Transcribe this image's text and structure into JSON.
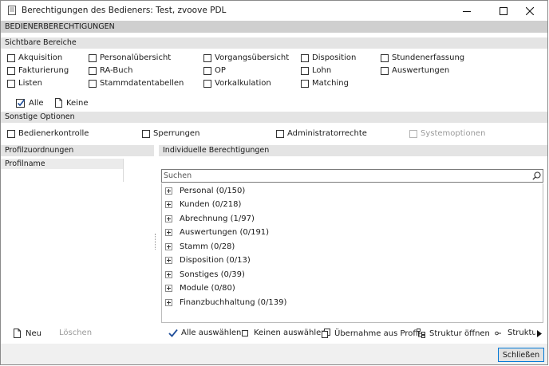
{
  "window": {
    "title": "Berechtigungen des Bedieners: Test, zvoove PDL",
    "section_title": "BEDIENERBERECHTIGUNGEN"
  },
  "sichtbare_bereiche": {
    "header": "Sichtbare Bereiche",
    "items": [
      {
        "label": "Akquisition",
        "checked": false
      },
      {
        "label": "Personalübersicht",
        "checked": false
      },
      {
        "label": "Vorgangsübersicht",
        "checked": false
      },
      {
        "label": "Disposition",
        "checked": false
      },
      {
        "label": "Stundenerfassung",
        "checked": false
      },
      {
        "label": "Fakturierung",
        "checked": false
      },
      {
        "label": "RA-Buch",
        "checked": false
      },
      {
        "label": "OP",
        "checked": false
      },
      {
        "label": "Lohn",
        "checked": false
      },
      {
        "label": "Auswertungen",
        "checked": false
      },
      {
        "label": "Listen",
        "checked": false
      },
      {
        "label": "Stammdatentabellen",
        "checked": false
      },
      {
        "label": "Vorkalkulation",
        "checked": false
      },
      {
        "label": "Matching",
        "checked": false
      }
    ],
    "select_all_label": "Alle",
    "select_none_label": "Keine"
  },
  "sonstige_optionen": {
    "header": "Sonstige Optionen",
    "items": [
      {
        "label": "Bedienerkontrolle",
        "checked": false,
        "enabled": true
      },
      {
        "label": "Sperrungen",
        "checked": false,
        "enabled": true
      },
      {
        "label": "Administratorrechte",
        "checked": false,
        "enabled": true
      },
      {
        "label": "Systemoptionen",
        "checked": false,
        "enabled": false
      }
    ]
  },
  "profilzuordnungen": {
    "header": "Profilzuordnungen",
    "column_header": "Profilname",
    "new_label": "Neu",
    "delete_label": "Löschen"
  },
  "individuelle_berechtigungen": {
    "header": "Individuelle Berechtigungen",
    "search_placeholder": "Suchen",
    "tree": [
      "Personal (0/150)",
      "Kunden (0/218)",
      "Abrechnung (1/97)",
      "Auswertungen (0/191)",
      "Stamm (0/28)",
      "Disposition (0/13)",
      "Sonstiges (0/39)",
      "Module (0/80)",
      "Finanzbuchhaltung (0/139)"
    ],
    "toolbar": {
      "select_all": "Alle auswählen",
      "select_none": "Keinen auswählen",
      "take_from_profile": "Übernahme aus Profil",
      "open_structure": "Struktur öffnen",
      "structure_truncated": "Struktu"
    }
  },
  "footer": {
    "close_label": "Schließen"
  },
  "colors": {
    "accent": "#0078d7",
    "header_bg": "#e4e4e4",
    "main_header_bg": "#cfcfcf"
  }
}
